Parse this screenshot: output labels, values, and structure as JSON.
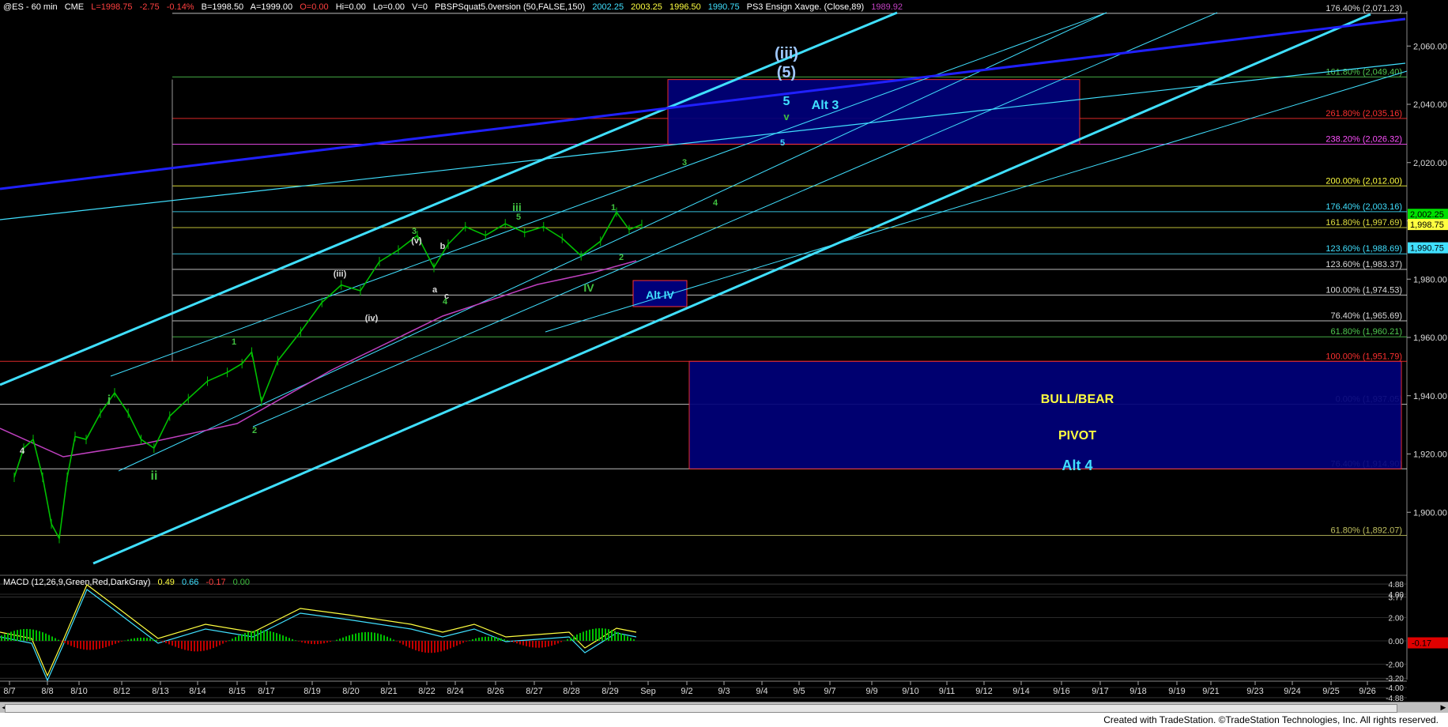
{
  "header": {
    "symbol": "@ES - 60 min",
    "exchange": "CME",
    "last": "L=1998.75",
    "chg": "-2.75",
    "pct": "-0.14%",
    "bid": "B=1998.50",
    "ask": "A=1999.00",
    "open": "O=0.00",
    "hi": "Hi=0.00",
    "lo": "Lo=0.00",
    "vol": "V=0",
    "study1": "PBSPSquat5.0version (50,FALSE,150)",
    "s1v1": "2002.25",
    "s1v2": "2003.25",
    "s1v3": "1996.50",
    "s1v4": "1990.75",
    "study2": "PS3 Ensign Xavge. (Close,89)",
    "s2v1": "1989.92"
  },
  "macd": {
    "label": "MACD (12,26,9,Green,Red,DarkGray)",
    "v1": "0.49",
    "v2": "0.66",
    "v3": "-0.17",
    "v4": "0.00",
    "axis": [
      "4.88",
      "3.77",
      "4.00",
      "2.00",
      "0.00",
      "-2.00",
      "-3.20",
      "-4.00",
      "-4.88"
    ],
    "current": "-0.17"
  },
  "credit": "Created with TradeStation. ©TradeStation Technologies, Inc. All rights reserved.",
  "colors": {
    "background": "#000000",
    "price_bar": "#00c000",
    "channel": "#40e0ff",
    "trend_blue": "#2020ff",
    "ma_magenta": "#c040c0",
    "zone_fill": "#00007a",
    "fib_red": "#ff3030",
    "fib_green": "#50c850",
    "fib_yellow": "#ffff40",
    "wave_label": "#40c040",
    "macd_line": "#ffff40",
    "macd_signal": "#40e0ff"
  },
  "chart_data": {
    "type": "line",
    "title": "@ES - 60 min",
    "ylim": [
      1880,
      2072
    ],
    "y_ticks": [
      "2,060.00",
      "2,040.00",
      "2,020.00",
      "2,000.00",
      "1,980.00",
      "1,960.00",
      "1,940.00",
      "1,920.00",
      "1,900.00"
    ],
    "x_ticks": [
      "8/7",
      "8/8",
      "8/10",
      "8/12",
      "8/13",
      "8/14",
      "8/15",
      "8/17",
      "8/19",
      "8/20",
      "8/21",
      "8/22",
      "8/24",
      "8/26",
      "8/27",
      "8/28",
      "8/29",
      "Sep",
      "9/2",
      "9/3",
      "9/4",
      "9/5",
      "9/7",
      "9/9",
      "9/10",
      "9/11",
      "9/12",
      "9/14",
      "9/16",
      "9/17",
      "9/18",
      "9/19",
      "9/21",
      "9/23",
      "9/24",
      "9/25",
      "9/26"
    ],
    "price_path": [
      [
        "8/7",
        1912
      ],
      [
        "8/7",
        1922
      ],
      [
        "8/7",
        1925
      ],
      [
        "8/7",
        1912
      ],
      [
        "8/8",
        1896
      ],
      [
        "8/8",
        1891
      ],
      [
        "8/8",
        1912
      ],
      [
        "8/8",
        1926
      ],
      [
        "8/10",
        1925
      ],
      [
        "8/10",
        1934
      ],
      [
        "8/10",
        1941
      ],
      [
        "8/12",
        1934
      ],
      [
        "8/12",
        1925
      ],
      [
        "8/12",
        1922
      ],
      [
        "8/13",
        1933
      ],
      [
        "8/13",
        1939
      ],
      [
        "8/14",
        1945
      ],
      [
        "8/14",
        1948
      ],
      [
        "8/15",
        1951
      ],
      [
        "8/15",
        1955
      ],
      [
        "8/15",
        1938
      ],
      [
        "8/17",
        1952
      ],
      [
        "8/17",
        1962
      ],
      [
        "8/19",
        1972
      ],
      [
        "8/19",
        1978
      ],
      [
        "8/20",
        1976
      ],
      [
        "8/20",
        1986
      ],
      [
        "8/21",
        1990
      ],
      [
        "8/21",
        1995
      ],
      [
        "8/22",
        1984
      ],
      [
        "8/22",
        1992
      ],
      [
        "8/24",
        1998
      ],
      [
        "8/24",
        1995
      ],
      [
        "8/26",
        1999
      ],
      [
        "8/26",
        1996
      ],
      [
        "8/27",
        1998
      ],
      [
        "8/27",
        1994
      ],
      [
        "8/28",
        1988
      ],
      [
        "8/28",
        1993
      ],
      [
        "8/29",
        2003
      ],
      [
        "8/29",
        1997
      ],
      [
        "8/29",
        1998.75
      ]
    ],
    "current_price": "1,998.75",
    "price_tags": [
      {
        "value": 2002.25,
        "label": "2,002.25",
        "color": "#00e000"
      },
      {
        "value": 1998.75,
        "label": "1,998.75",
        "color": "#ffff40"
      },
      {
        "value": 1990.75,
        "label": "1,990.75",
        "color": "#40e0ff"
      }
    ],
    "fib_levels": [
      {
        "value": 2071.23,
        "label": "176.40% (2,071.23)",
        "color": "#dddddd"
      },
      {
        "value": 2049.4,
        "label": "161.80% (2,049.40)",
        "color": "#50c850"
      },
      {
        "value": 2035.16,
        "label": "261.80% (2,035.16)",
        "color": "#ff3030"
      },
      {
        "value": 2026.32,
        "label": "238.20% (2,026.32)",
        "color": "#ff50ff"
      },
      {
        "value": 2012.0,
        "label": "200.00% (2,012.00)",
        "color": "#ffff40"
      },
      {
        "value": 2003.16,
        "label": "176.40% (2,003.16)",
        "color": "#40e0ff"
      },
      {
        "value": 1997.69,
        "label": "161.80% (1,997.69)",
        "color": "#e0e040"
      },
      {
        "value": 1988.69,
        "label": "123.60% (1,988.69)",
        "color": "#40e0ff"
      },
      {
        "value": 1983.37,
        "label": "123.60% (1,983.37)",
        "color": "#dddddd"
      },
      {
        "value": 1974.53,
        "label": "100.00% (1,974.53)",
        "color": "#dddddd"
      },
      {
        "value": 1965.69,
        "label": "76.40% (1,965.69)",
        "color": "#dddddd"
      },
      {
        "value": 1960.21,
        "label": "61.80% (1,960.21)",
        "color": "#50c850"
      },
      {
        "value": 1951.79,
        "label": "100.00% (1,951.79)",
        "color": "#ff3030"
      },
      {
        "value": 1937.05,
        "label": "0.00% (1,937.05)",
        "color": "#dddddd"
      },
      {
        "value": 1914.9,
        "label": "76.40% (1,914.90)",
        "color": "#dddddd"
      },
      {
        "value": 1892.07,
        "label": "61.80% (1,892.07)",
        "color": "#c0c060"
      }
    ],
    "zones": [
      {
        "name": "Alt 3",
        "top": 2048.5,
        "bottom": 2026.32,
        "x0": "8/29",
        "x1": "9/16"
      },
      {
        "name": "BULL/BEAR PIVOT Alt 4",
        "top": 1951.79,
        "bottom": 1914.9,
        "x0": "Sep",
        "x1": "9/26"
      }
    ],
    "zone_labels": {
      "alt3": "Alt 3",
      "bull_bear": "BULL/BEAR",
      "pivot": "PIVOT",
      "alt4": "Alt 4",
      "alt_iv": "Alt IV"
    },
    "wave_labels": [
      {
        "text": "(iii)",
        "color": "#a0c8ff"
      },
      {
        "text": "(5)",
        "color": "#a0c8ff"
      },
      {
        "text": "5",
        "color": "#40e0ff"
      },
      {
        "text": "v",
        "color": "#40c040"
      },
      {
        "text": "5",
        "color": "#40e0ff"
      },
      {
        "text": "3",
        "color": "#40c040"
      },
      {
        "text": "4",
        "color": "#40c040"
      },
      {
        "text": "iii",
        "color": "#40c040"
      },
      {
        "text": "5",
        "color": "#40c040"
      },
      {
        "text": "1",
        "color": "#40c040"
      },
      {
        "text": "3",
        "color": "#40c040"
      },
      {
        "text": "(v)",
        "color": "#dddddd"
      },
      {
        "text": "b",
        "color": "#dddddd"
      },
      {
        "text": "(iii)",
        "color": "#dddddd"
      },
      {
        "text": "a",
        "color": "#dddddd"
      },
      {
        "text": "c",
        "color": "#dddddd"
      },
      {
        "text": "4",
        "color": "#40c040"
      },
      {
        "text": "(iv)",
        "color": "#dddddd"
      },
      {
        "text": "IV",
        "color": "#40c040"
      },
      {
        "text": "2",
        "color": "#40c040"
      },
      {
        "text": "1",
        "color": "#40c040"
      },
      {
        "text": "i",
        "color": "#40c040"
      },
      {
        "text": "ii",
        "color": "#40c040"
      },
      {
        "text": "4",
        "color": "#dddddd"
      },
      {
        "text": "2",
        "color": "#40c040"
      }
    ],
    "grid": false
  }
}
